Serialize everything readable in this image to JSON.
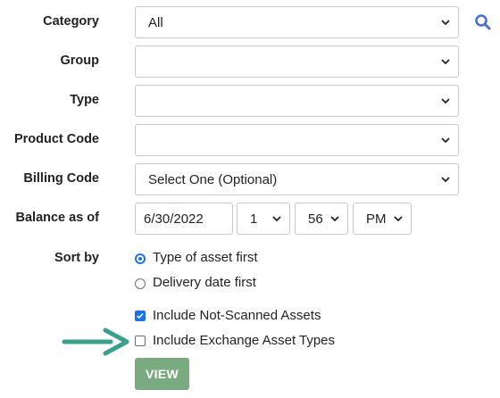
{
  "colors": {
    "accent": "#1a73e8",
    "button_bg": "#7aab80",
    "arrow": "#3aa089",
    "search_icon": "#4a6fd8"
  },
  "form": {
    "category": {
      "label": "Category",
      "value": "All"
    },
    "group": {
      "label": "Group",
      "value": ""
    },
    "type": {
      "label": "Type",
      "value": ""
    },
    "product_code": {
      "label": "Product Code",
      "value": ""
    },
    "billing_code": {
      "label": "Billing Code",
      "value": "Select One (Optional)"
    },
    "balance_as_of": {
      "label": "Balance as of",
      "date": "6/30/2022",
      "hour": "1",
      "minute": "56",
      "ampm": "PM"
    },
    "sort_by": {
      "label": "Sort by",
      "options": [
        {
          "label": "Type of asset first",
          "selected": true
        },
        {
          "label": "Delivery date first",
          "selected": false
        }
      ]
    },
    "checkboxes": [
      {
        "label": "Include Not-Scanned Assets",
        "checked": true
      },
      {
        "label": "Include Exchange Asset Types",
        "checked": false
      }
    ],
    "view_button": "VIEW"
  },
  "icons": {
    "search": "search-icon",
    "chevron": "chevron-down-icon",
    "pointer_arrow": "arrow-right-icon"
  }
}
